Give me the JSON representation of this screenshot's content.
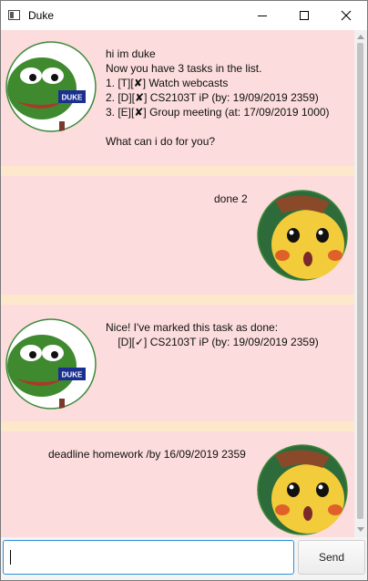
{
  "window": {
    "title": "Duke",
    "controls": {
      "minimize_icon": "minimize-icon",
      "maximize_icon": "maximize-icon",
      "close_icon": "close-icon"
    }
  },
  "colors": {
    "row_background": "#fcdcdc",
    "separator": "#fde8cc",
    "input_border": "#2b8fd8"
  },
  "messages": [
    {
      "sender": "duke",
      "avatar_icon": "pepe-duke-avatar",
      "lines": [
        "hi im duke",
        "Now you have 3 tasks in the list.",
        "1. [T][✘] Watch webcasts",
        "2. [D][✘] CS2103T iP (by: 19/09/2019 2359)",
        "3. [E][✘] Group meeting (at: 17/09/2019 1000)",
        "",
        "What can i do for you?"
      ]
    },
    {
      "sender": "user",
      "avatar_icon": "pikachu-avatar",
      "lines": [
        "done 2"
      ]
    },
    {
      "sender": "duke",
      "avatar_icon": "pepe-duke-avatar",
      "lines": [
        "Nice! I've marked this task as done:",
        "    [D][✓] CS2103T iP (by: 19/09/2019 2359)"
      ]
    },
    {
      "sender": "user",
      "avatar_icon": "pikachu-avatar",
      "lines": [
        "deadline homework /by 16/09/2019 2359"
      ]
    }
  ],
  "input": {
    "value": "",
    "placeholder": ""
  },
  "send_button": {
    "label": "Send"
  }
}
